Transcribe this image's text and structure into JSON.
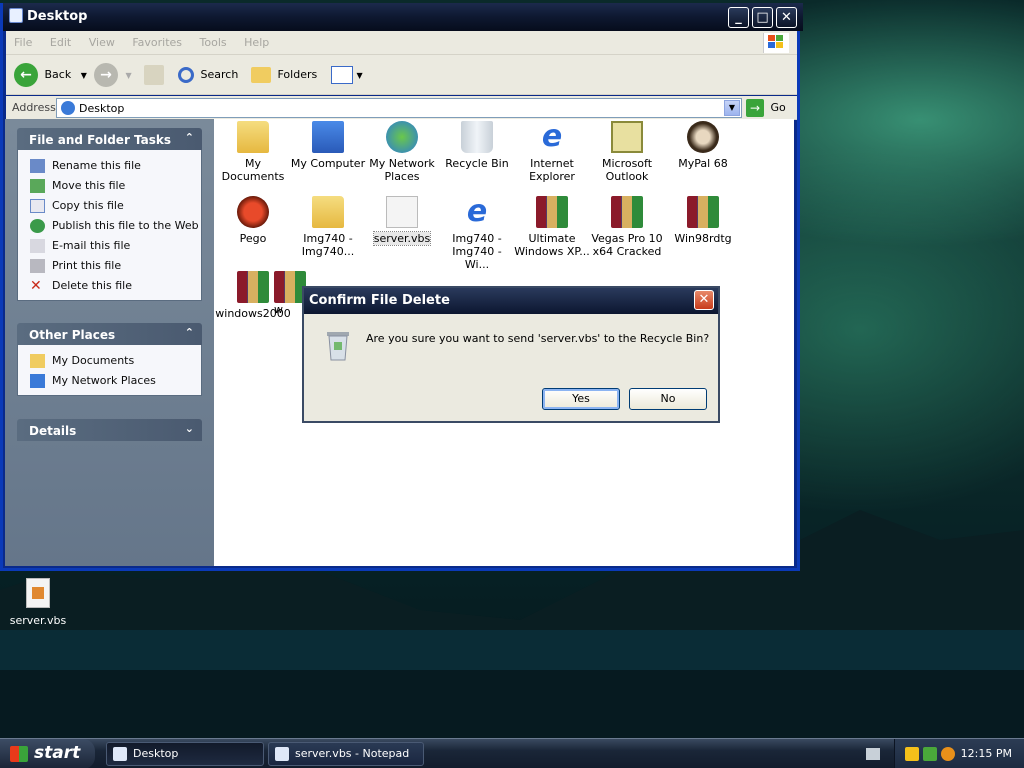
{
  "window": {
    "title": "Desktop",
    "menu": [
      "File",
      "Edit",
      "View",
      "Favorites",
      "Tools",
      "Help"
    ],
    "toolbar": {
      "back": "Back",
      "search": "Search",
      "folders": "Folders"
    },
    "address": {
      "label": "Address",
      "value": "Desktop",
      "go": "Go"
    }
  },
  "sidebar": {
    "file_tasks": {
      "title": "File and Folder Tasks",
      "items": [
        "Rename this file",
        "Move this file",
        "Copy this file",
        "Publish this file to the Web",
        "E-mail this file",
        "Print this file",
        "Delete this file"
      ]
    },
    "other_places": {
      "title": "Other Places",
      "items": [
        "My Documents",
        "My Network Places"
      ]
    },
    "details": {
      "title": "Details"
    }
  },
  "files": [
    {
      "l1": "My Documents",
      "l2": ""
    },
    {
      "l1": "My Computer",
      "l2": ""
    },
    {
      "l1": "My Network",
      "l2": "Places"
    },
    {
      "l1": "Recycle Bin",
      "l2": ""
    },
    {
      "l1": "Internet",
      "l2": "Explorer"
    },
    {
      "l1": "Microsoft",
      "l2": "Outlook"
    },
    {
      "l1": "MyPal 68",
      "l2": ""
    },
    {
      "l1": "Pego",
      "l2": ""
    },
    {
      "l1": "Img740 -",
      "l2": "Img740..."
    },
    {
      "l1": "server.vbs",
      "l2": ""
    },
    {
      "l1": "Img740 -",
      "l2": "Img740 - Wi..."
    },
    {
      "l1": "Ultimate",
      "l2": "Windows XP..."
    },
    {
      "l1": "Vegas Pro 10",
      "l2": "x64 Cracked"
    },
    {
      "l1": "Win98rdtg",
      "l2": ""
    },
    {
      "l1": "windows2000",
      "l2": ""
    },
    {
      "l1": "w",
      "l2": ""
    }
  ],
  "dialog": {
    "title": "Confirm File Delete",
    "message": "Are you sure you want to send 'server.vbs' to the Recycle Bin?",
    "yes": "Yes",
    "no": "No"
  },
  "desktop_icon": {
    "label": "server.vbs"
  },
  "taskbar": {
    "start": "start",
    "tasks": [
      "Desktop",
      "server.vbs - Notepad"
    ],
    "time": "12:15 PM"
  }
}
